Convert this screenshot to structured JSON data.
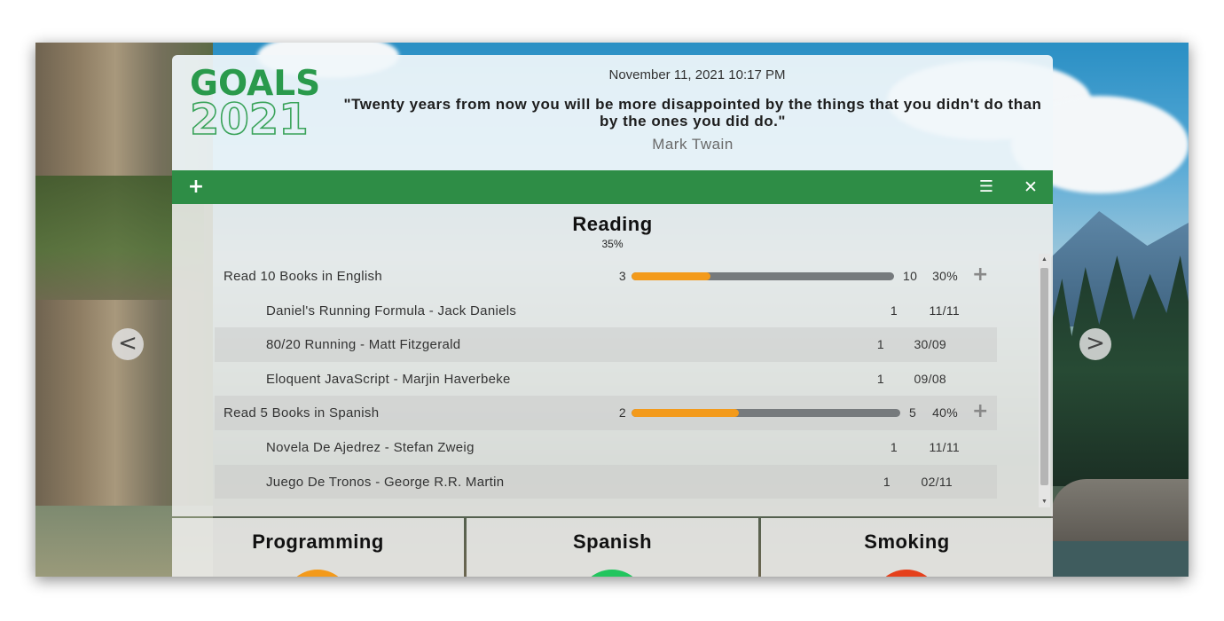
{
  "app": {
    "logo": {
      "line1": "GOALS",
      "line2": "2021"
    },
    "datetime": "November 11, 2021 10:17 PM",
    "quote": "\"Twenty years from now you will be more disappointed by the things that you didn't do than by the ones you did do.\"",
    "author": "Mark Twain"
  },
  "toolbar": {
    "add_icon": "plus-icon",
    "menu_icon": "hamburger-menu-icon",
    "close_icon": "close-icon",
    "add_glyph": "+",
    "menu_glyph": "☰",
    "close_glyph": "✕"
  },
  "nav": {
    "prev_glyph": "<",
    "next_glyph": ">"
  },
  "category": {
    "title": "Reading",
    "percent": "35%",
    "goals": [
      {
        "label": "Read 10 Books in English",
        "start": "3",
        "target": "10",
        "percent": "30%",
        "progress": 0.3,
        "plus": "+",
        "entries": [
          {
            "label": "Daniel's Running Formula - Jack Daniels",
            "qty": "1",
            "date": "11/11"
          },
          {
            "label": "80/20 Running - Matt Fitzgerald",
            "qty": "1",
            "date": "30/09"
          },
          {
            "label": "Eloquent JavaScript - Marjin Haverbeke",
            "qty": "1",
            "date": "09/08"
          }
        ]
      },
      {
        "label": "Read 5 Books in Spanish",
        "start": "2",
        "target": "5",
        "percent": "40%",
        "progress": 0.4,
        "plus": "+",
        "entries": [
          {
            "label": "Novela De Ajedrez - Stefan Zweig",
            "qty": "1",
            "date": "11/11"
          },
          {
            "label": "Juego De Tronos - George R.R. Martin",
            "qty": "1",
            "date": "02/11"
          }
        ]
      }
    ]
  },
  "cards": [
    {
      "title": "Programming",
      "color": "#f39a1b"
    },
    {
      "title": "Spanish",
      "color": "#22c55e"
    },
    {
      "title": "Smoking",
      "color": "#e5401c"
    }
  ],
  "colors": {
    "accent": "#2e8d46",
    "progress_fill": "#f39a1b",
    "progress_track": "#767a7d"
  }
}
